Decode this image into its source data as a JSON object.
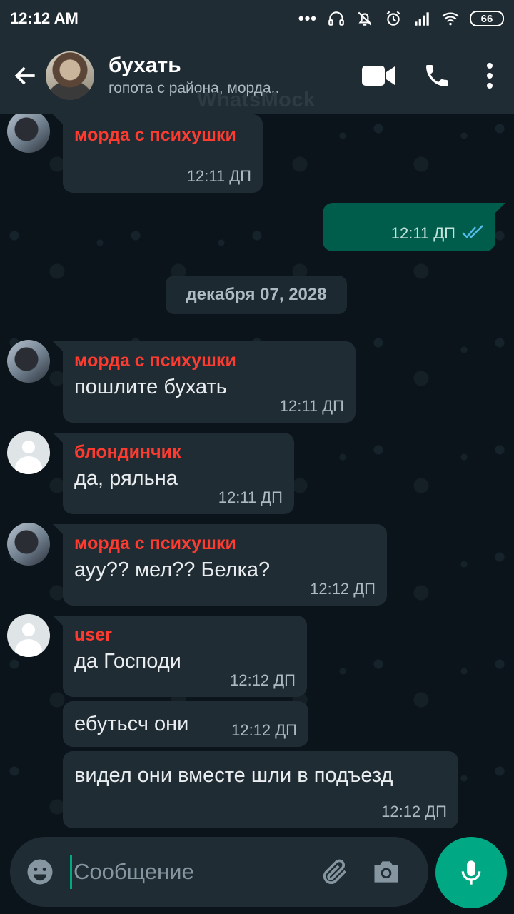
{
  "status_bar": {
    "time": "12:12 AM",
    "dots": "•••",
    "battery": "66"
  },
  "header": {
    "title": "бухать",
    "subtitle": "гопота с района, морда..",
    "watermark": "WhatsMock"
  },
  "chat": {
    "date_separator": "декабря 07, 2028",
    "messages": [
      {
        "sender": "морда с психушки",
        "text": "",
        "time": "12:11 ДП",
        "direction": "in"
      },
      {
        "text": "",
        "time": "12:11 ДП",
        "direction": "out",
        "status": "read"
      },
      {
        "sender": "морда с психушки",
        "text": "пошлите бухать",
        "time": "12:11 ДП",
        "direction": "in"
      },
      {
        "sender": "блондинчик",
        "text": "да, ряльна",
        "time": "12:11 ДП",
        "direction": "in"
      },
      {
        "sender": "морда с психушки",
        "text": "ауу?? мел?? Белка?",
        "time": "12:12 ДП",
        "direction": "in"
      },
      {
        "sender": "user",
        "text": "да Господи",
        "time": "12:12 ДП",
        "direction": "in"
      },
      {
        "text": "ебутьсч они",
        "time": "12:12 ДП",
        "direction": "in"
      },
      {
        "text": "видел они вместе шли в подъезд",
        "time": "12:12 ДП",
        "direction": "in"
      }
    ]
  },
  "input": {
    "placeholder": "Сообщение"
  },
  "colors": {
    "background": "#0b141a",
    "bar": "#1f2c34",
    "incoming_bubble": "#202c33",
    "outgoing_bubble": "#005c4b",
    "accent": "#00a884",
    "sender_name": "#ff3b30",
    "read_ticks": "#53bdeb"
  }
}
